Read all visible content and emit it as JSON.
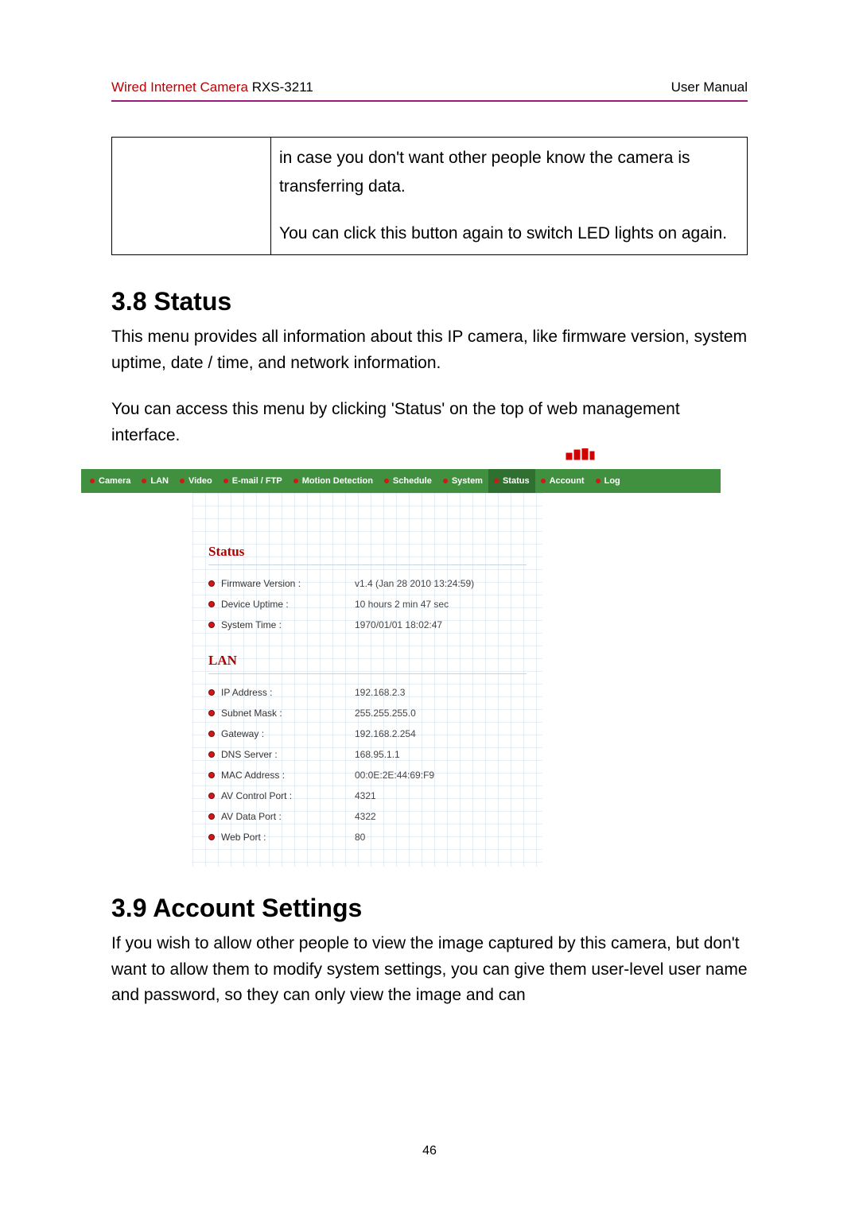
{
  "header": {
    "product_red": "Wired Internet Camera",
    "model": "RXS-3211",
    "right": "User Manual"
  },
  "note_box": {
    "p1": "in case you don't want other people know the camera is transferring data.",
    "p2": "You can click this button again to switch LED lights on again."
  },
  "section_status": {
    "heading": "3.8 Status",
    "p1": "This menu provides all information about this IP camera, like firmware version, system uptime, date / time, and network information.",
    "p2": "You can access this menu by clicking 'Status' on the top of web management interface."
  },
  "nav": {
    "items": [
      {
        "label": "Camera"
      },
      {
        "label": "LAN"
      },
      {
        "label": "Video"
      },
      {
        "label": "E-mail / FTP"
      },
      {
        "label": "Motion Detection"
      },
      {
        "label": "Schedule"
      },
      {
        "label": "System"
      },
      {
        "label": "Status",
        "active": true
      },
      {
        "label": "Account"
      },
      {
        "label": "Log"
      }
    ]
  },
  "status_panel": {
    "title_status": "Status",
    "title_lan": "LAN",
    "rows_status": [
      {
        "k": "Firmware Version :",
        "v": "v1.4 (Jan 28 2010 13:24:59)"
      },
      {
        "k": "Device Uptime :",
        "v": "10 hours 2 min 47 sec"
      },
      {
        "k": "System Time :",
        "v": "1970/01/01 18:02:47"
      }
    ],
    "rows_lan": [
      {
        "k": "IP Address :",
        "v": "192.168.2.3"
      },
      {
        "k": "Subnet Mask :",
        "v": "255.255.255.0"
      },
      {
        "k": "Gateway :",
        "v": "192.168.2.254"
      },
      {
        "k": "DNS Server :",
        "v": "168.95.1.1"
      },
      {
        "k": "MAC Address :",
        "v": "00:0E:2E:44:69:F9"
      },
      {
        "k": "AV Control Port :",
        "v": "4321"
      },
      {
        "k": "AV Data Port :",
        "v": "4322"
      },
      {
        "k": "Web Port :",
        "v": "80"
      }
    ]
  },
  "section_account": {
    "heading": "3.9 Account Settings",
    "p1": "If you wish to allow other people to view the image captured by this camera, but don't want to allow them to modify system settings, you can give them user-level user name and password, so they can only view the image and can"
  },
  "page_number": "46"
}
